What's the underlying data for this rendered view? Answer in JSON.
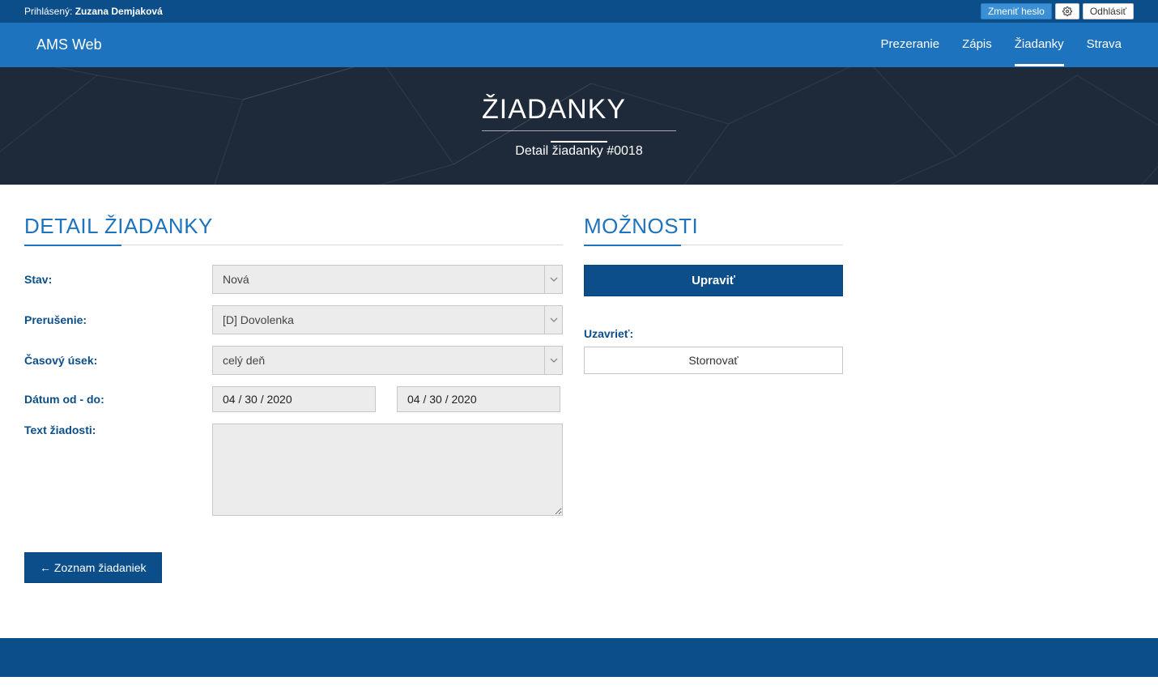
{
  "topbar": {
    "logged_in_label": "Prihlásený:",
    "user_name": "Zuzana Demjaková",
    "change_password": "Zmeniť heslo",
    "logout": "Odhlásiť"
  },
  "brand": "AMS Web",
  "nav": {
    "items": [
      {
        "label": "Prezeranie",
        "active": false
      },
      {
        "label": "Zápis",
        "active": false
      },
      {
        "label": "Žiadanky",
        "active": true
      },
      {
        "label": "Strava",
        "active": false
      }
    ]
  },
  "hero": {
    "title": "ŽIADANKY",
    "subtitle": "Detail žiadanky #0018"
  },
  "detail": {
    "section_title": "DETAIL ŽIADANKY",
    "stav_label": "Stav:",
    "stav_value": "Nová",
    "prerusenie_label": "Prerušenie:",
    "prerusenie_value": "[D] Dovolenka",
    "casovy_label": "Časový úsek:",
    "casovy_value": "celý deň",
    "datum_label": "Dátum od - do:",
    "datum_od": "04 / 30 / 2020",
    "datum_do": "04 / 30 / 2020",
    "text_label": "Text žiadosti:",
    "text_value": "",
    "back_button": "← Zoznam žiadaniek"
  },
  "options": {
    "section_title": "MOŽNOSTI",
    "upravit": "Upraviť",
    "uzavriet_label": "Uzavrieť:",
    "stornovat": "Stornovať"
  }
}
